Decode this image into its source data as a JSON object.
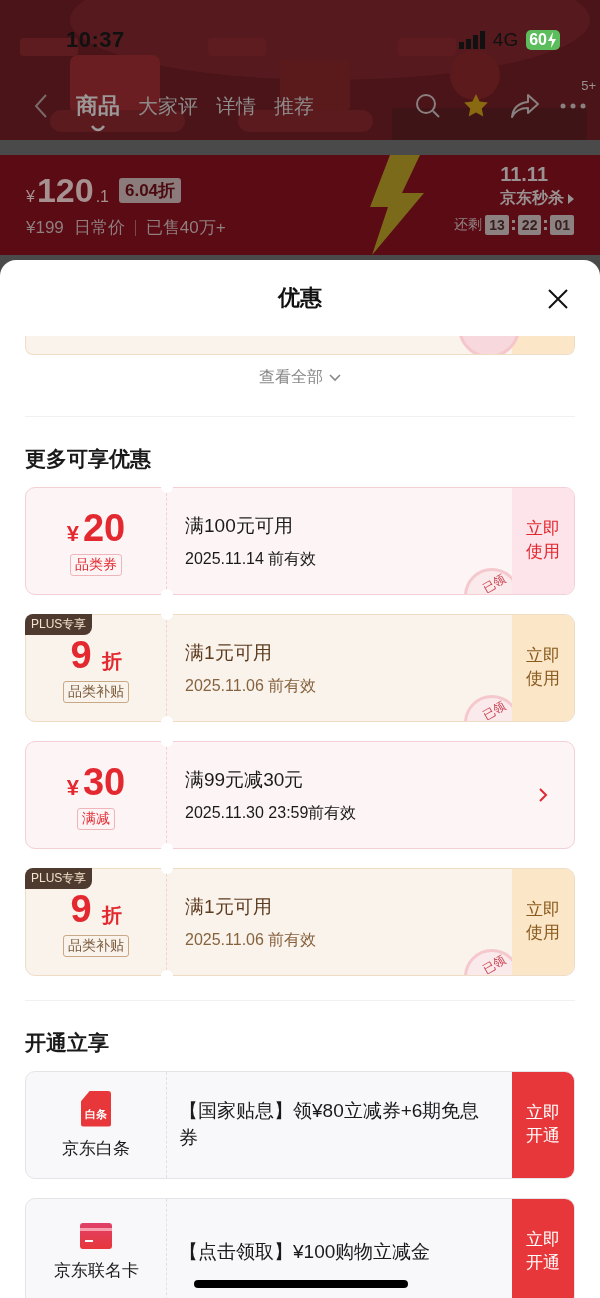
{
  "status_bar": {
    "time": "10:37",
    "network": "4G",
    "battery": "60"
  },
  "nav": {
    "tabs": [
      {
        "label": "商品",
        "selected": true
      },
      {
        "label": "大家评",
        "selected": false
      },
      {
        "label": "详情",
        "selected": false
      },
      {
        "label": "推荐",
        "selected": false
      }
    ],
    "more_badge": "5+"
  },
  "price_bar": {
    "currency": "¥",
    "price_int": "120",
    "price_dec": ".1",
    "discount": "6.04折",
    "original_price": "¥199",
    "original_label": "日常价",
    "sold": "已售40万+",
    "event_logo": "11.11",
    "event_name": "京东秒杀",
    "countdown_label": "还剩",
    "countdown": [
      "13",
      "22",
      "01"
    ]
  },
  "sheet": {
    "title": "优惠",
    "view_all": "查看全部",
    "more_section": {
      "title": "更多可享优惠",
      "coupons": [
        {
          "kind": "pink",
          "currency": "¥",
          "amount": "20",
          "tag": "品类券",
          "condition": "满100元可用",
          "validity": "2025.11.14 前有效",
          "action": "立即使用",
          "stamp": "已领"
        },
        {
          "kind": "gold",
          "plus_badge": "PLUS专享",
          "amount": "9",
          "unit": "折",
          "tag": "品类补贴",
          "condition": "满1元可用",
          "validity": "2025.11.06 前有效",
          "action": "立即使用",
          "stamp": "已领"
        },
        {
          "kind": "pink",
          "currency": "¥",
          "amount": "30",
          "tag": "满减",
          "condition": "满99元减30元",
          "validity": "2025.11.30 23:59前有效",
          "arrow": true
        },
        {
          "kind": "gold",
          "plus_badge": "PLUS专享",
          "amount": "9",
          "unit": "折",
          "tag": "品类补贴",
          "condition": "满1元可用",
          "validity": "2025.11.06 前有效",
          "action": "立即使用",
          "stamp": "已领"
        }
      ]
    },
    "open_section": {
      "title": "开通立享",
      "offers": [
        {
          "kind": "baitiao",
          "icon_label": "白条",
          "name": "京东白条",
          "text": "【国家贴息】领¥80立减券+6期免息券",
          "action": "立即开通"
        },
        {
          "kind": "card",
          "name": "京东联名卡",
          "text": "【点击领取】¥100购物立减金",
          "action": "立即开通"
        }
      ]
    }
  }
}
